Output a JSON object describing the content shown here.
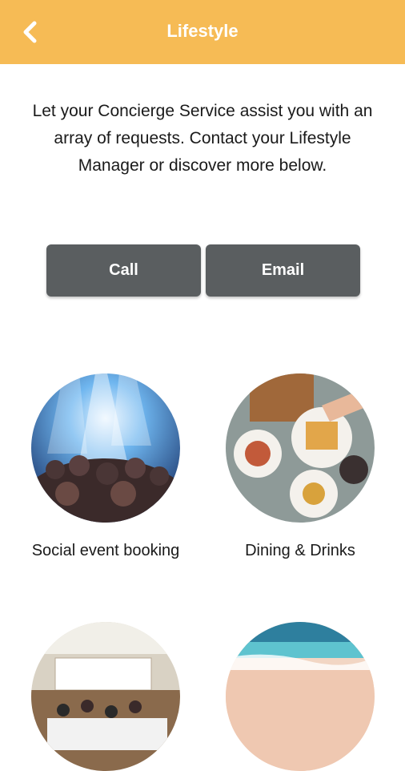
{
  "header": {
    "title": "Lifestyle",
    "back_icon": "chevron-left-icon",
    "background": "#f6bb55"
  },
  "intro": {
    "text": "Let your Concierge Service assist you with an array of requests. Contact your Lifestyle Manager or discover more below."
  },
  "actions": {
    "call_label": "Call",
    "email_label": "Email",
    "button_color": "#5a5e60"
  },
  "categories": [
    {
      "label": "Social event booking"
    },
    {
      "label": "Dining & Drinks"
    },
    {
      "label": ""
    },
    {
      "label": ""
    }
  ]
}
